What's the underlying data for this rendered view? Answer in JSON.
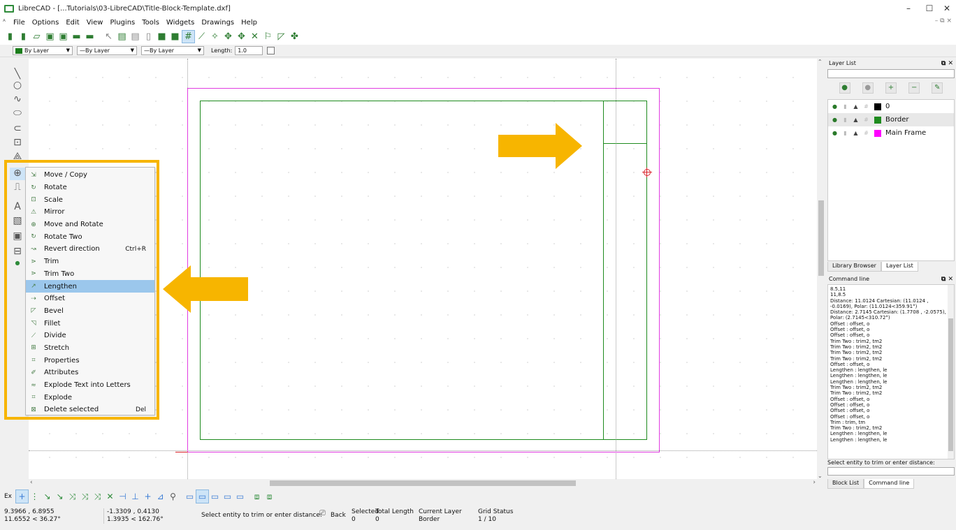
{
  "window": {
    "title": "LibreCAD - [...Tutorials\\03-LibreCAD\\Title-Block-Template.dxf]",
    "controls": [
      "–",
      "☐",
      "✕"
    ]
  },
  "menubar": {
    "items": [
      "File",
      "Options",
      "Edit",
      "View",
      "Plugins",
      "Tools",
      "Widgets",
      "Drawings",
      "Help"
    ],
    "mdi_controls": "– ⧉ ×"
  },
  "pen_toolbar": {
    "color": "By Layer",
    "color_swatch": "#1a7d1a",
    "linetype": "By Layer",
    "linewidth": "By Layer",
    "length_label": "Length:",
    "length_value": "1.0"
  },
  "modify_menu": {
    "items": [
      {
        "label": "Move / Copy",
        "shortcut": "",
        "icon": "move-copy-icon"
      },
      {
        "label": "Rotate",
        "shortcut": "",
        "icon": "rotate-icon"
      },
      {
        "label": "Scale",
        "shortcut": "",
        "icon": "scale-icon"
      },
      {
        "label": "Mirror",
        "shortcut": "",
        "icon": "mirror-icon"
      },
      {
        "label": "Move and Rotate",
        "shortcut": "",
        "icon": "move-rotate-icon"
      },
      {
        "label": "Rotate Two",
        "shortcut": "",
        "icon": "rotate-two-icon"
      },
      {
        "label": "Revert direction",
        "shortcut": "Ctrl+R",
        "icon": "revert-direction-icon"
      },
      {
        "label": "Trim",
        "shortcut": "",
        "icon": "trim-icon"
      },
      {
        "label": "Trim Two",
        "shortcut": "",
        "icon": "trim-two-icon"
      },
      {
        "label": "Lengthen",
        "shortcut": "",
        "icon": "lengthen-icon"
      },
      {
        "label": "Offset",
        "shortcut": "",
        "icon": "offset-icon"
      },
      {
        "label": "Bevel",
        "shortcut": "",
        "icon": "bevel-icon"
      },
      {
        "label": "Fillet",
        "shortcut": "",
        "icon": "fillet-icon"
      },
      {
        "label": "Divide",
        "shortcut": "",
        "icon": "divide-icon"
      },
      {
        "label": "Stretch",
        "shortcut": "",
        "icon": "stretch-icon"
      },
      {
        "label": "Properties",
        "shortcut": "",
        "icon": "properties-icon"
      },
      {
        "label": "Attributes",
        "shortcut": "",
        "icon": "attributes-icon"
      },
      {
        "label": "Explode Text into Letters",
        "shortcut": "",
        "icon": "explode-text-icon"
      },
      {
        "label": "Explode",
        "shortcut": "",
        "icon": "explode-icon"
      },
      {
        "label": "Delete selected",
        "shortcut": "Del",
        "icon": "delete-icon"
      }
    ],
    "highlighted": "Lengthen"
  },
  "layer_list": {
    "title": "Layer List",
    "layers": [
      {
        "name": "0",
        "color": "#000000"
      },
      {
        "name": "Border",
        "color": "#1f8b1f"
      },
      {
        "name": "Main Frame",
        "color": "#ff00ff"
      }
    ],
    "tabs": [
      "Library Browser",
      "Layer List"
    ],
    "active_tab": "Layer List"
  },
  "command_line": {
    "title": "Command line",
    "history": [
      "8.5,11",
      "11,8.5",
      "Distance: 11.0124 Cartesian: (11.0124 ,",
      "-0.0169), Polar: (11.0124<359.91°)",
      "Distance: 2.7145 Cartesian: (1.7708 , -2.0575),",
      "Polar: (2.7145<310.72°)",
      "Offset : offset, o",
      "Offset : offset, o",
      "Offset : offset, o",
      "Trim Two : trim2, tm2",
      "Trim Two : trim2, tm2",
      "Trim Two : trim2, tm2",
      "Trim Two : trim2, tm2",
      "Offset : offset, o",
      "Lengthen : lengthen, le",
      "Lengthen : lengthen, le",
      "Lengthen : lengthen, le",
      "Trim Two : trim2, tm2",
      "Trim Two : trim2, tm2",
      "Offset : offset, o",
      "Offset : offset, o",
      "Offset : offset, o",
      "Offset : offset, o",
      "Trim : trim, tm",
      "Trim Two : trim2, tm2",
      "Lengthen : lengthen, le",
      "Lengthen : lengthen, le"
    ],
    "prompt": "Select entity to trim or enter distance:",
    "tabs": [
      "Block List",
      "Command line"
    ],
    "active_tab": "Command line"
  },
  "snap_toolbar": {
    "label": "Ex"
  },
  "status_bar": {
    "abs_coord": "9.3966 , 6.8955",
    "abs_polar": "11.6552 < 36.27°",
    "rel_coord": "-1.3309 , 0.4130",
    "rel_polar": "1.3935 < 162.76°",
    "prompt": "Select entity to trim or enter distance:",
    "back_label": "Back",
    "selected_label": "Selected",
    "selected_value": "0",
    "total_length_label": "Total Length",
    "total_length_value": "0",
    "current_layer_label": "Current Layer",
    "current_layer_value": "Border",
    "grid_status_label": "Grid Status",
    "grid_status_value": "1 / 10"
  },
  "annotation_color": "#f7b500"
}
